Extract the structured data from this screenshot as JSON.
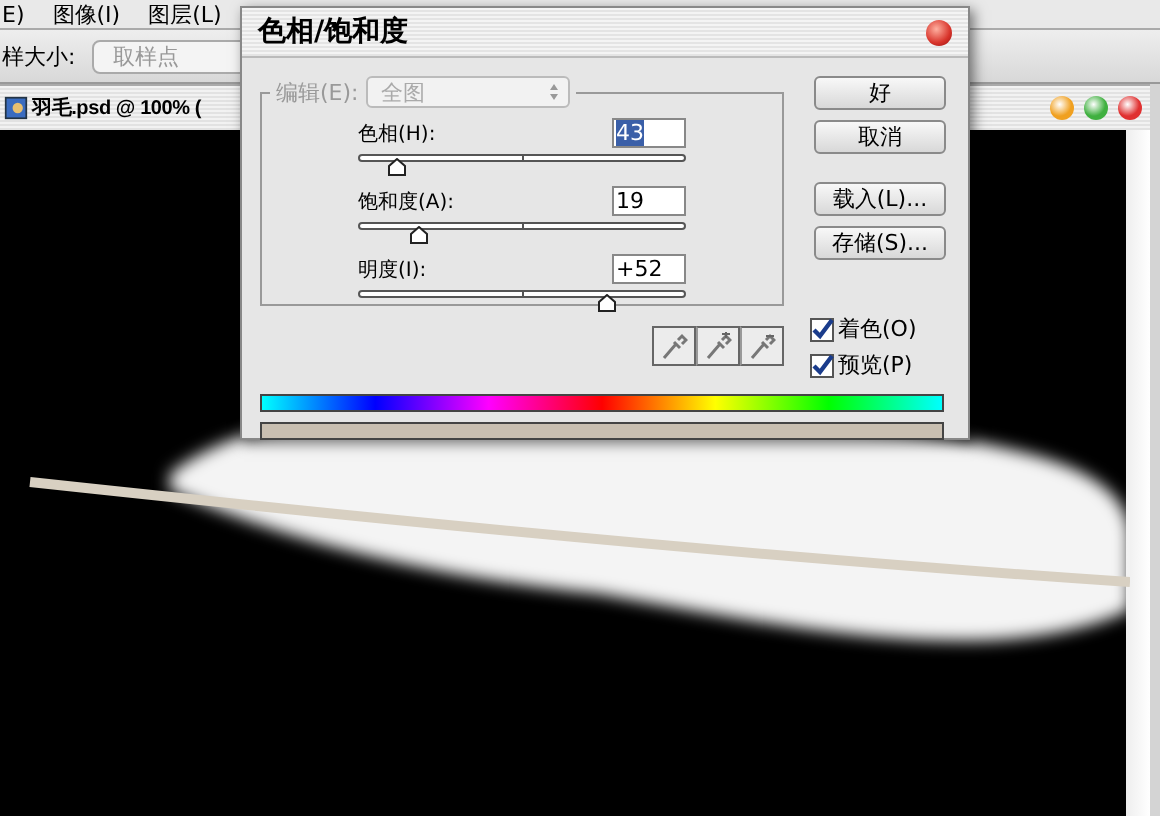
{
  "menu_bar": {
    "items": [
      "E)",
      "图像(I)",
      "图层(L)"
    ]
  },
  "options_bar": {
    "label": "样大小:",
    "dropdown": {
      "value": "取样点",
      "disabled": true
    }
  },
  "document": {
    "title": "羽毛.psd @ 100% ("
  },
  "dialog": {
    "title": "色相/饱和度",
    "edit": {
      "label": "编辑(E):",
      "value": "全图",
      "disabled": true
    },
    "sliders": [
      {
        "label": "色相(H):",
        "value": "43",
        "level": 0.12,
        "selected": true
      },
      {
        "label": "饱和度(A):",
        "value": "19",
        "level": 0.19,
        "selected": false
      },
      {
        "label": "明度(I):",
        "value": "+52",
        "level": 0.76,
        "selected": false
      }
    ],
    "buttons": [
      "好",
      "取消",
      "载入(L)...",
      "存储(S)..."
    ],
    "checkboxes": [
      {
        "label": "着色(O)",
        "checked": true
      },
      {
        "label": "预览(P)",
        "checked": true
      }
    ]
  }
}
